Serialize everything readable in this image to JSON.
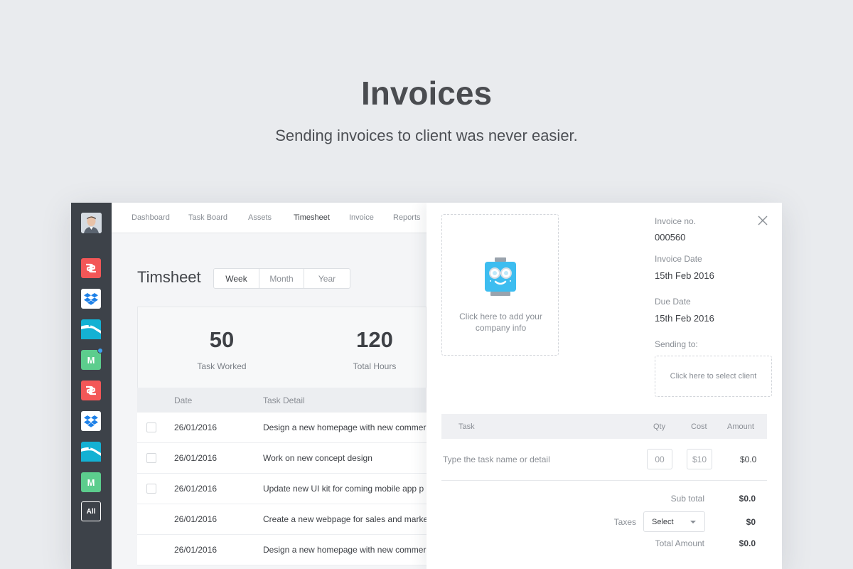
{
  "hero": {
    "title": "Invoices",
    "subtitle": "Sending invoices to client was never easier."
  },
  "rail": {
    "apps": [
      {
        "name": "speaker-deck-icon",
        "color": "#f35757"
      },
      {
        "name": "dropbox-icon",
        "color": "#ffffff"
      },
      {
        "name": "pelican-icon",
        "color": "#14b1d3"
      },
      {
        "name": "medium-icon",
        "color": "#5ccd8d",
        "letter": "M"
      },
      {
        "name": "speaker-deck-icon",
        "color": "#f35757"
      },
      {
        "name": "dropbox-icon",
        "color": "#ffffff"
      },
      {
        "name": "pelican-icon",
        "color": "#14b1d3"
      },
      {
        "name": "medium-icon",
        "color": "#5ccd8d",
        "letter": "M"
      }
    ],
    "all_label": "All"
  },
  "nav": [
    "Dashboard",
    "Task Board",
    "Assets",
    "Timesheet",
    "Invoice",
    "Reports"
  ],
  "nav_active": "Timesheet",
  "timesheet": {
    "title": "Timsheet",
    "segments": [
      "Week",
      "Month",
      "Year"
    ],
    "segment_active": "Week",
    "stats": [
      {
        "value": "50",
        "label": "Task Worked"
      },
      {
        "value": "120",
        "label": "Total Hours"
      }
    ],
    "columns": [
      "Date",
      "Task Detail"
    ],
    "rows": [
      {
        "date": "26/01/2016",
        "task": "Design a new homepage with new commer",
        "checkbox": true
      },
      {
        "date": "26/01/2016",
        "task": "Work on new concept design",
        "checkbox": true
      },
      {
        "date": "26/01/2016",
        "task": "Update new UI kit for coming mobile app p",
        "checkbox": true
      },
      {
        "date": "26/01/2016",
        "task": "Create a new webpage for sales and marke",
        "checkbox": false
      },
      {
        "date": "26/01/2016",
        "task": "Design a new homepage with new commer",
        "checkbox": false
      }
    ]
  },
  "invoice": {
    "company_prompt": "Click here to add your company info",
    "invoice_no_label": "Invoice no.",
    "invoice_no": "000560",
    "invoice_date_label": "Invoice Date",
    "invoice_date": "15th Feb 2016",
    "due_date_label": "Due Date",
    "due_date": "15th Feb 2016",
    "sending_to_label": "Sending to:",
    "client_prompt": "Click here to select client",
    "columns": {
      "task": "Task",
      "qty": "Qty",
      "cost": "Cost",
      "amount": "Amount"
    },
    "item": {
      "task_placeholder": "Type the task name or detail",
      "qty_placeholder": "00",
      "cost_placeholder": "$10",
      "amount": "$0.0"
    },
    "subtotal_label": "Sub total",
    "subtotal": "$0.0",
    "taxes_label": "Taxes",
    "taxes_select": "Select",
    "taxes": "$0",
    "total_label": "Total Amount",
    "total": "$0.0"
  }
}
